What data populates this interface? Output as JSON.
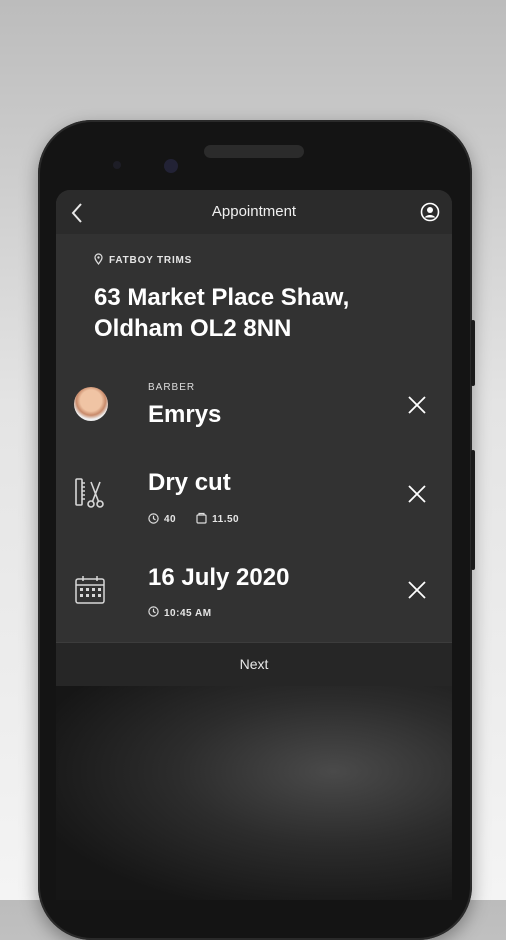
{
  "header": {
    "title": "Appointment",
    "back_icon": "back-arrow-icon",
    "profile_icon": "user-profile-icon"
  },
  "shop": {
    "name": "FATBOY TRIMS",
    "address": "63 Market Place Shaw, Oldham OL2 8NN"
  },
  "barber": {
    "label": "BARBER",
    "name": "Emrys"
  },
  "service": {
    "name": "Dry cut",
    "duration": "40",
    "price": "11.50"
  },
  "date": {
    "value": "16 July 2020",
    "time": "10:45 AM"
  },
  "footer": {
    "next_label": "Next"
  },
  "colors": {
    "screen_bg": "#323232",
    "topbar_bg": "#2b2b2b",
    "text": "#ffffff"
  }
}
